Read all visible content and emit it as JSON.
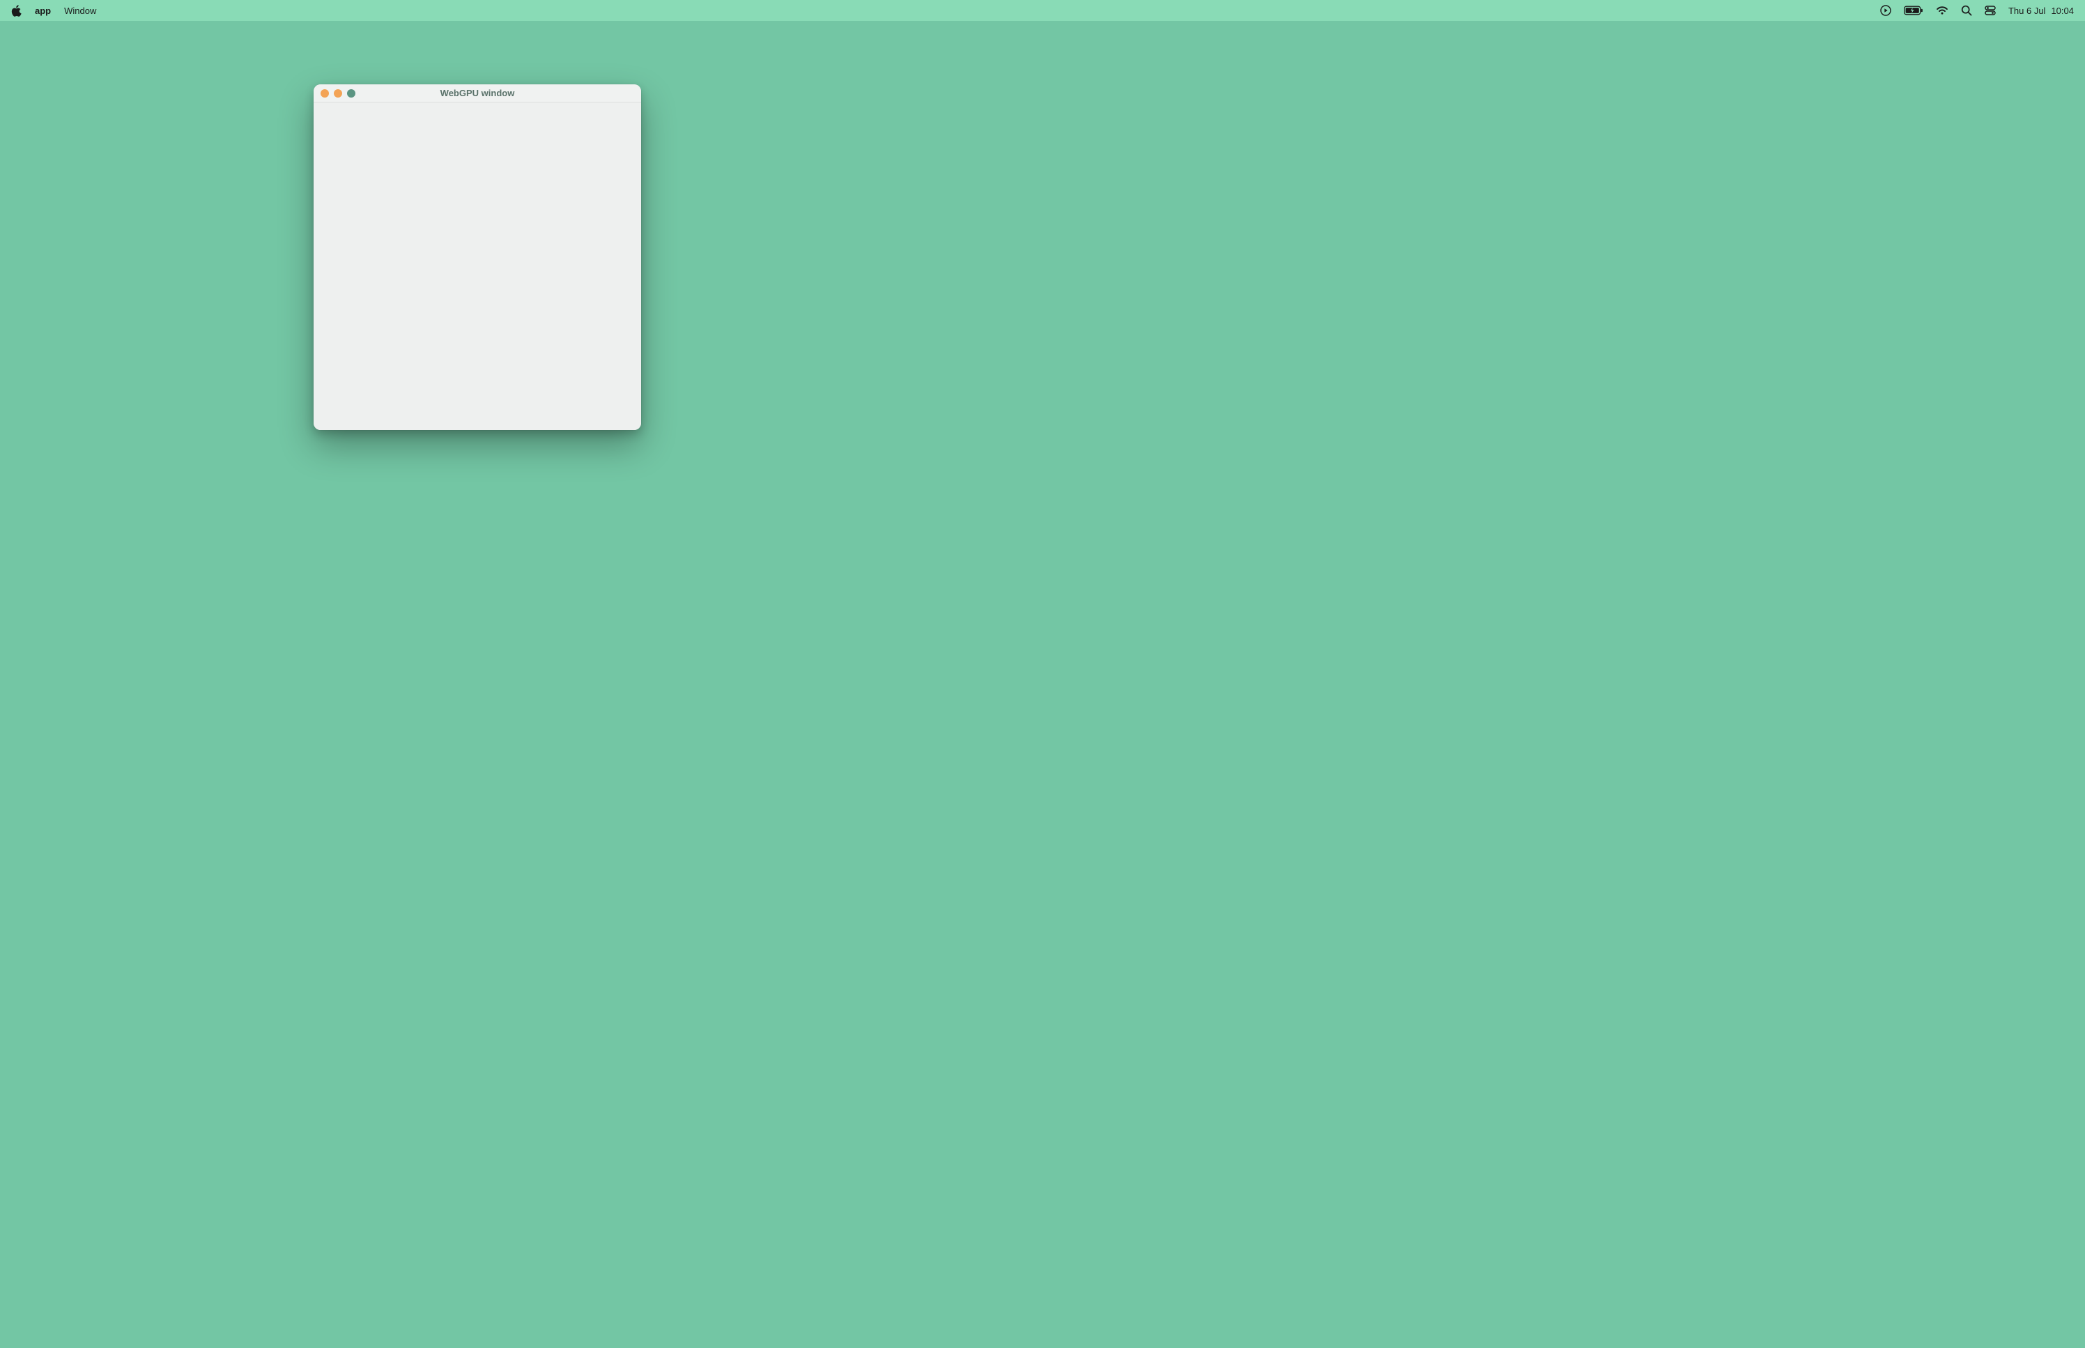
{
  "menubar": {
    "app_name": "app",
    "menus": [
      "Window"
    ],
    "datetime": {
      "date": "Thu 6 Jul",
      "time": "10:04"
    }
  },
  "window": {
    "title": "WebGPU window"
  },
  "icons": {
    "apple": "apple-icon",
    "play": "play-in-circle-icon",
    "battery": "battery-charging-icon",
    "wifi": "wifi-icon",
    "search": "search-icon",
    "control_center": "control-center-icon",
    "traffic": {
      "close": "close-icon",
      "minimize": "minimize-icon",
      "zoom": "zoom-icon"
    }
  }
}
